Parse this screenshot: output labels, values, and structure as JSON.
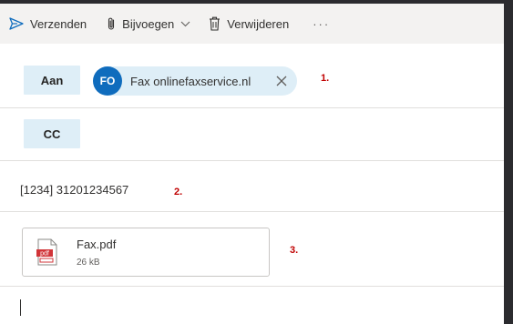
{
  "toolbar": {
    "send_label": "Verzenden",
    "attach_label": "Bijvoegen",
    "delete_label": "Verwijderen",
    "more_label": "···",
    "icons": {
      "send": "send-icon",
      "attach": "paperclip-icon",
      "attach_dropdown": "chevron-down-icon",
      "delete": "trash-icon"
    },
    "accent_color": "#0f6cbd"
  },
  "recipients": {
    "to_label": "Aan",
    "to_chip": {
      "initials": "FO",
      "label": "Fax onlinefaxservice.nl",
      "avatar_color": "#0f6cbd"
    },
    "cc_label": "CC"
  },
  "subject": {
    "value": "[1234] 31201234567"
  },
  "attachment": {
    "name": "Fax.pdf",
    "size": "26 kB",
    "icon": "pdf-file-icon"
  },
  "annotations": {
    "step1": "1.",
    "step2": "2.",
    "step3": "3.",
    "color": "#c00000"
  }
}
